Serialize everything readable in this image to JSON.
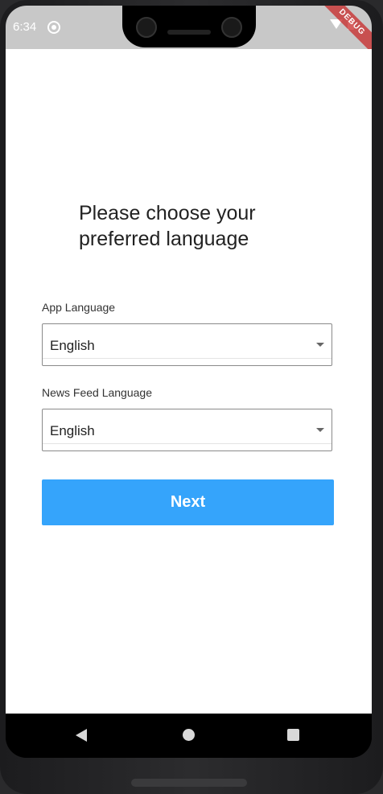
{
  "status_bar": {
    "time": "6:34",
    "debug_banner": "DEBUG"
  },
  "page": {
    "title_line1": "Please choose your",
    "title_line2": "preferred language"
  },
  "app_language": {
    "label": "App Language",
    "value": "English"
  },
  "news_feed_language": {
    "label": "News Feed Language",
    "value": "English"
  },
  "next_button": {
    "label": "Next",
    "color": "#35a4fb"
  }
}
